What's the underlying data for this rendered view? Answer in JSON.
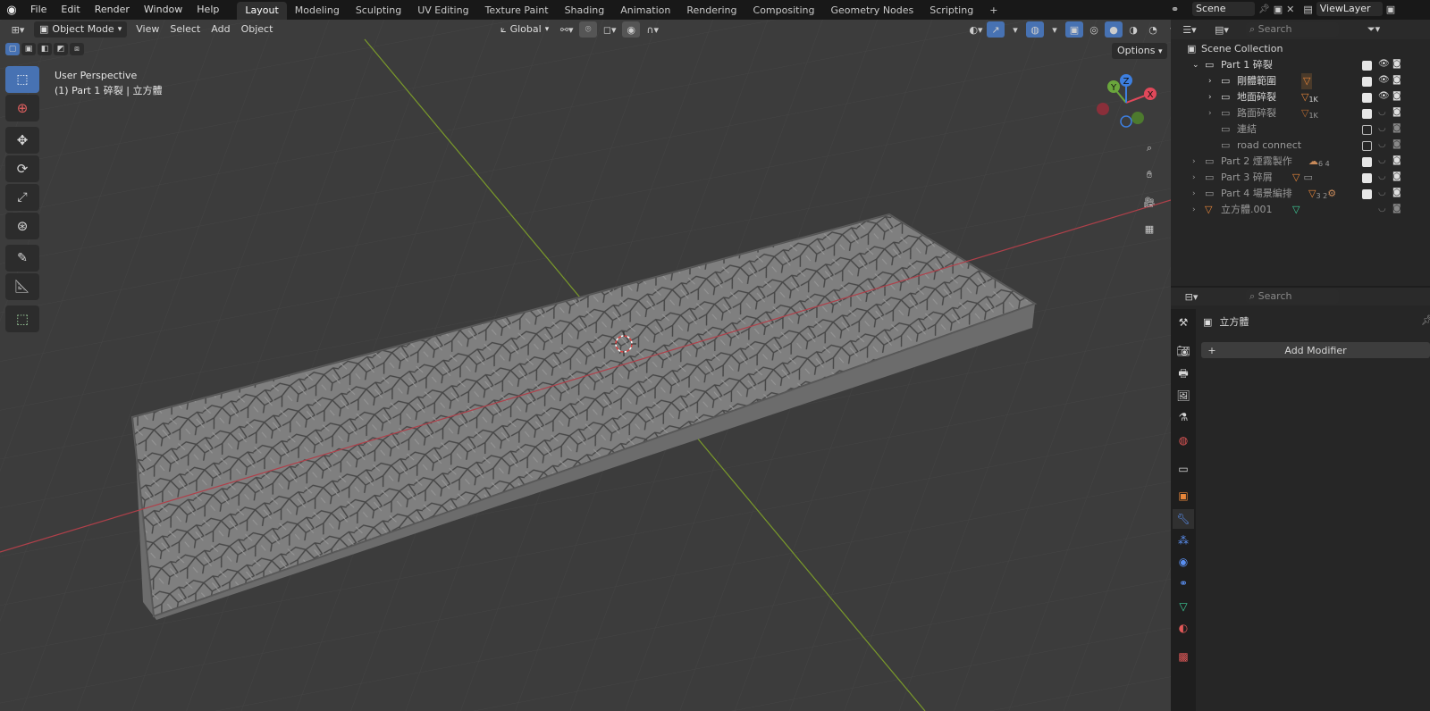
{
  "menu": [
    "File",
    "Edit",
    "Render",
    "Window",
    "Help"
  ],
  "workspaces": [
    "Layout",
    "Modeling",
    "Sculpting",
    "UV Editing",
    "Texture Paint",
    "Shading",
    "Animation",
    "Rendering",
    "Compositing",
    "Geometry Nodes",
    "Scripting"
  ],
  "add_workspace": "+",
  "scene": {
    "name": "Scene",
    "view_layer": "ViewLayer"
  },
  "viewport_header": {
    "mode": "Object Mode",
    "menus": [
      "View",
      "Select",
      "Add",
      "Object"
    ],
    "transform_orientation": "Global",
    "options": "Options"
  },
  "overlay_text": {
    "perspective": "User Perspective",
    "object_info": "(1) Part 1 碎裂 | 立方體"
  },
  "gizmo": {
    "x": "X",
    "y": "Y",
    "z": "Z"
  },
  "outliner": {
    "search_placeholder": "Search",
    "root": "Scene Collection",
    "rows": [
      {
        "label": "Part 1 碎裂",
        "badge": ""
      },
      {
        "label": "剛體範圍",
        "badge": ""
      },
      {
        "label": "地面碎裂",
        "badge": "1K"
      },
      {
        "label": "路面碎裂",
        "badge": "1K"
      },
      {
        "label": "連結",
        "badge": ""
      },
      {
        "label": "road connect",
        "badge": ""
      },
      {
        "label": "Part 2 煙霧製作",
        "badge": "6  4"
      },
      {
        "label": "Part 3 碎屑",
        "badge": ""
      },
      {
        "label": "Part 4 場景編排",
        "badge": "3  2"
      },
      {
        "label": "立方體.001",
        "badge": ""
      }
    ]
  },
  "properties": {
    "search_placeholder": "Search",
    "object_name": "立方體",
    "add_modifier": "Add Modifier",
    "add_modifier_plus": "+"
  },
  "colors": {
    "accent": "#4772b3",
    "x_axis": "#e0485a",
    "y_axis": "#6aa63c",
    "z_axis": "#3d7fe0",
    "object_orange": "#e8863a"
  }
}
